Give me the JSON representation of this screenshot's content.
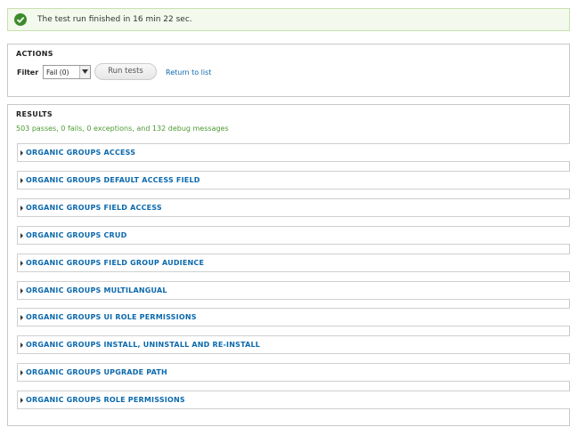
{
  "status": {
    "icon": "check-circle-icon",
    "message": "The test run finished in 16 min 22 sec."
  },
  "actions": {
    "legend": "ACTIONS",
    "filter_label": "Filter",
    "filter_value": "Fail (0)",
    "run_label": "Run tests",
    "return_label": "Return to list"
  },
  "results": {
    "legend": "RESULTS",
    "summary": "503 passes, 0 fails, 0 exceptions, and 132 debug messages",
    "groups": [
      "ORGANIC GROUPS ACCESS",
      "ORGANIC GROUPS DEFAULT ACCESS FIELD",
      "ORGANIC GROUPS FIELD ACCESS",
      "ORGANIC GROUPS CRUD",
      "ORGANIC GROUPS FIELD GROUP AUDIENCE",
      "ORGANIC GROUPS MULTILANGUAL",
      "ORGANIC GROUPS UI ROLE PERMISSIONS",
      "ORGANIC GROUPS INSTALL, UNINSTALL AND RE-INSTALL",
      "ORGANIC GROUPS UPGRADE PATH",
      "ORGANIC GROUPS ROLE PERMISSIONS"
    ]
  },
  "colors": {
    "link": "#0b69ad",
    "success": "#3c8b2d",
    "summary": "#4e9a33"
  }
}
